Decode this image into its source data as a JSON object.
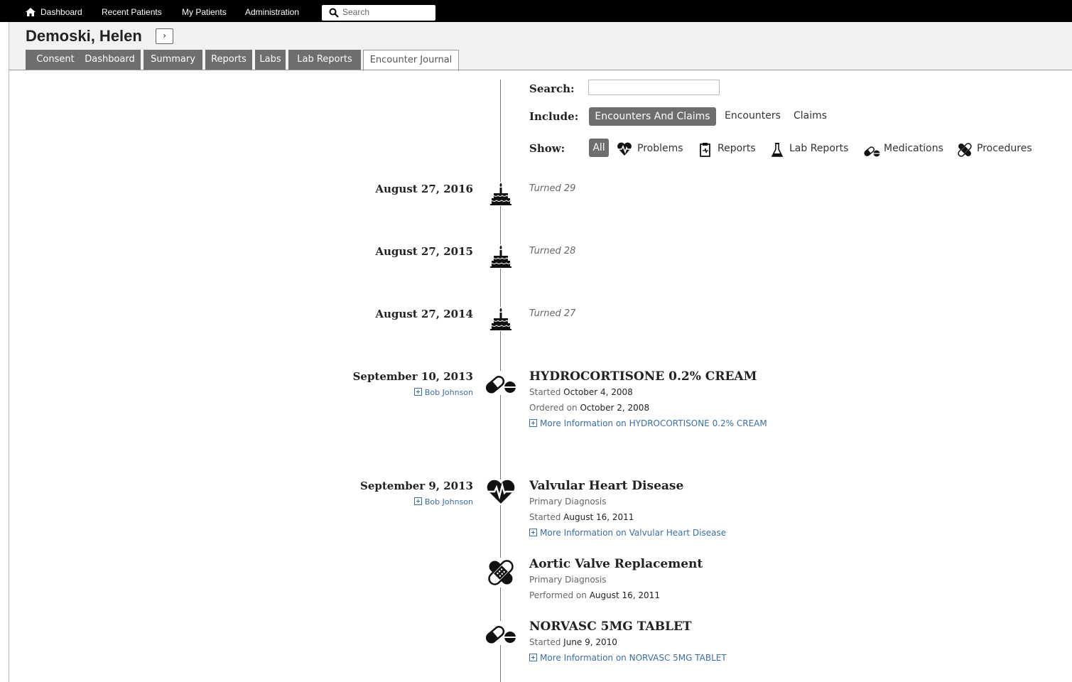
{
  "topnav": {
    "items": [
      "Dashboard",
      "Recent Patients",
      "My Patients",
      "Administration"
    ],
    "search_placeholder": "Search"
  },
  "patient": {
    "name": "Demoski, Helen",
    "expand_glyph": "›"
  },
  "tabs": [
    "Consent",
    "Dashboard",
    "Summary",
    "Reports",
    "Labs",
    "Lab Reports",
    "Encounter Journal"
  ],
  "active_tab": "Encounter Journal",
  "filters": {
    "search_label": "Search:",
    "search_value": "",
    "include_label": "Include:",
    "include_options": [
      "Encounters And Claims",
      "Encounters",
      "Claims"
    ],
    "include_selected": "Encounters And Claims",
    "show_label": "Show:",
    "show_all": "All",
    "show_options": [
      {
        "label": "Problems",
        "icon": "heart-pulse-icon"
      },
      {
        "label": "Reports",
        "icon": "clipboard-icon"
      },
      {
        "label": "Lab Reports",
        "icon": "flask-icon"
      },
      {
        "label": "Medications",
        "icon": "pills-icon"
      },
      {
        "label": "Procedures",
        "icon": "bandage-icon"
      }
    ]
  },
  "entries": [
    {
      "date": "August 27, 2016",
      "icon": "birthday-cake-icon",
      "note": "Turned 29"
    },
    {
      "date": "August 27, 2015",
      "icon": "birthday-cake-icon",
      "note": "Turned 28"
    },
    {
      "date": "August 27, 2014",
      "icon": "birthday-cake-icon",
      "note": "Turned 27"
    },
    {
      "date": "September 10, 2013",
      "author": "Bob Johnson",
      "icon": "pills-icon",
      "title": "HYDROCORTISONE 0.2% CREAM",
      "lines": [
        {
          "prefix": "Started",
          "value": "October 4, 2008"
        },
        {
          "prefix": "Ordered on",
          "value": "October 2, 2008"
        }
      ],
      "more": "More Information on HYDROCORTISONE 0.2% CREAM"
    },
    {
      "date": "September 9, 2013",
      "author": "Bob Johnson",
      "icon": "heart-pulse-icon",
      "title": "Valvular Heart Disease",
      "lines": [
        {
          "prefix": "Primary Diagnosis",
          "value": ""
        },
        {
          "prefix": "Started",
          "value": "August 16, 2011"
        }
      ],
      "more": "More Information on Valvular Heart Disease"
    },
    {
      "icon": "bandage-icon",
      "title": "Aortic Valve Replacement",
      "lines": [
        {
          "prefix": "Primary Diagnosis",
          "value": ""
        },
        {
          "prefix": "Performed on",
          "value": "August 16, 2011"
        }
      ]
    },
    {
      "icon": "pills-icon",
      "title": "NORVASC 5MG TABLET",
      "lines": [
        {
          "prefix": "Started",
          "value": "June 9, 2010"
        }
      ],
      "more": "More Information on NORVASC 5MG TABLET"
    }
  ]
}
